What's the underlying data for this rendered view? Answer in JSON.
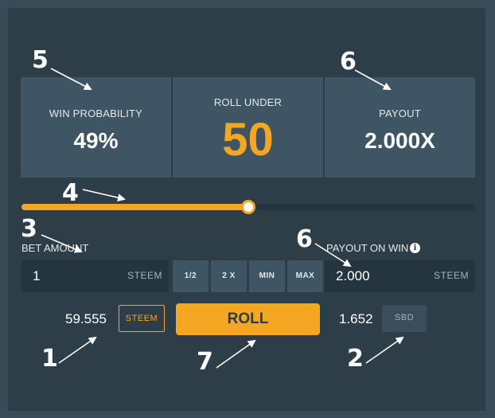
{
  "stats": {
    "win_probability": {
      "label": "WIN PROBABILITY",
      "value": "49%"
    },
    "roll_under": {
      "label": "ROLL UNDER",
      "value": "50"
    },
    "payout": {
      "label": "PAYOUT",
      "value": "2.000X"
    }
  },
  "slider": {
    "value_fraction": 0.49
  },
  "bet": {
    "label": "BET AMOUNT",
    "value": "1",
    "unit": "STEEM"
  },
  "quick_buttons": [
    "1/2",
    "2 X",
    "MIN",
    "MAX"
  ],
  "payout_on_win": {
    "label": "PAYOUT ON WIN",
    "value": "2.000",
    "unit": "STEEM",
    "info_icon": "i"
  },
  "balances": {
    "steem": {
      "amount": "59.555",
      "currency": "STEEM"
    },
    "sbd": {
      "amount": "1.652",
      "currency": "SBD"
    }
  },
  "roll_button": "ROLL",
  "annotations": [
    "1",
    "2",
    "3",
    "4",
    "5",
    "6",
    "6",
    "7"
  ],
  "colors": {
    "accent": "#f5a623",
    "panel": "#2e3e48",
    "card": "#3f5563"
  }
}
